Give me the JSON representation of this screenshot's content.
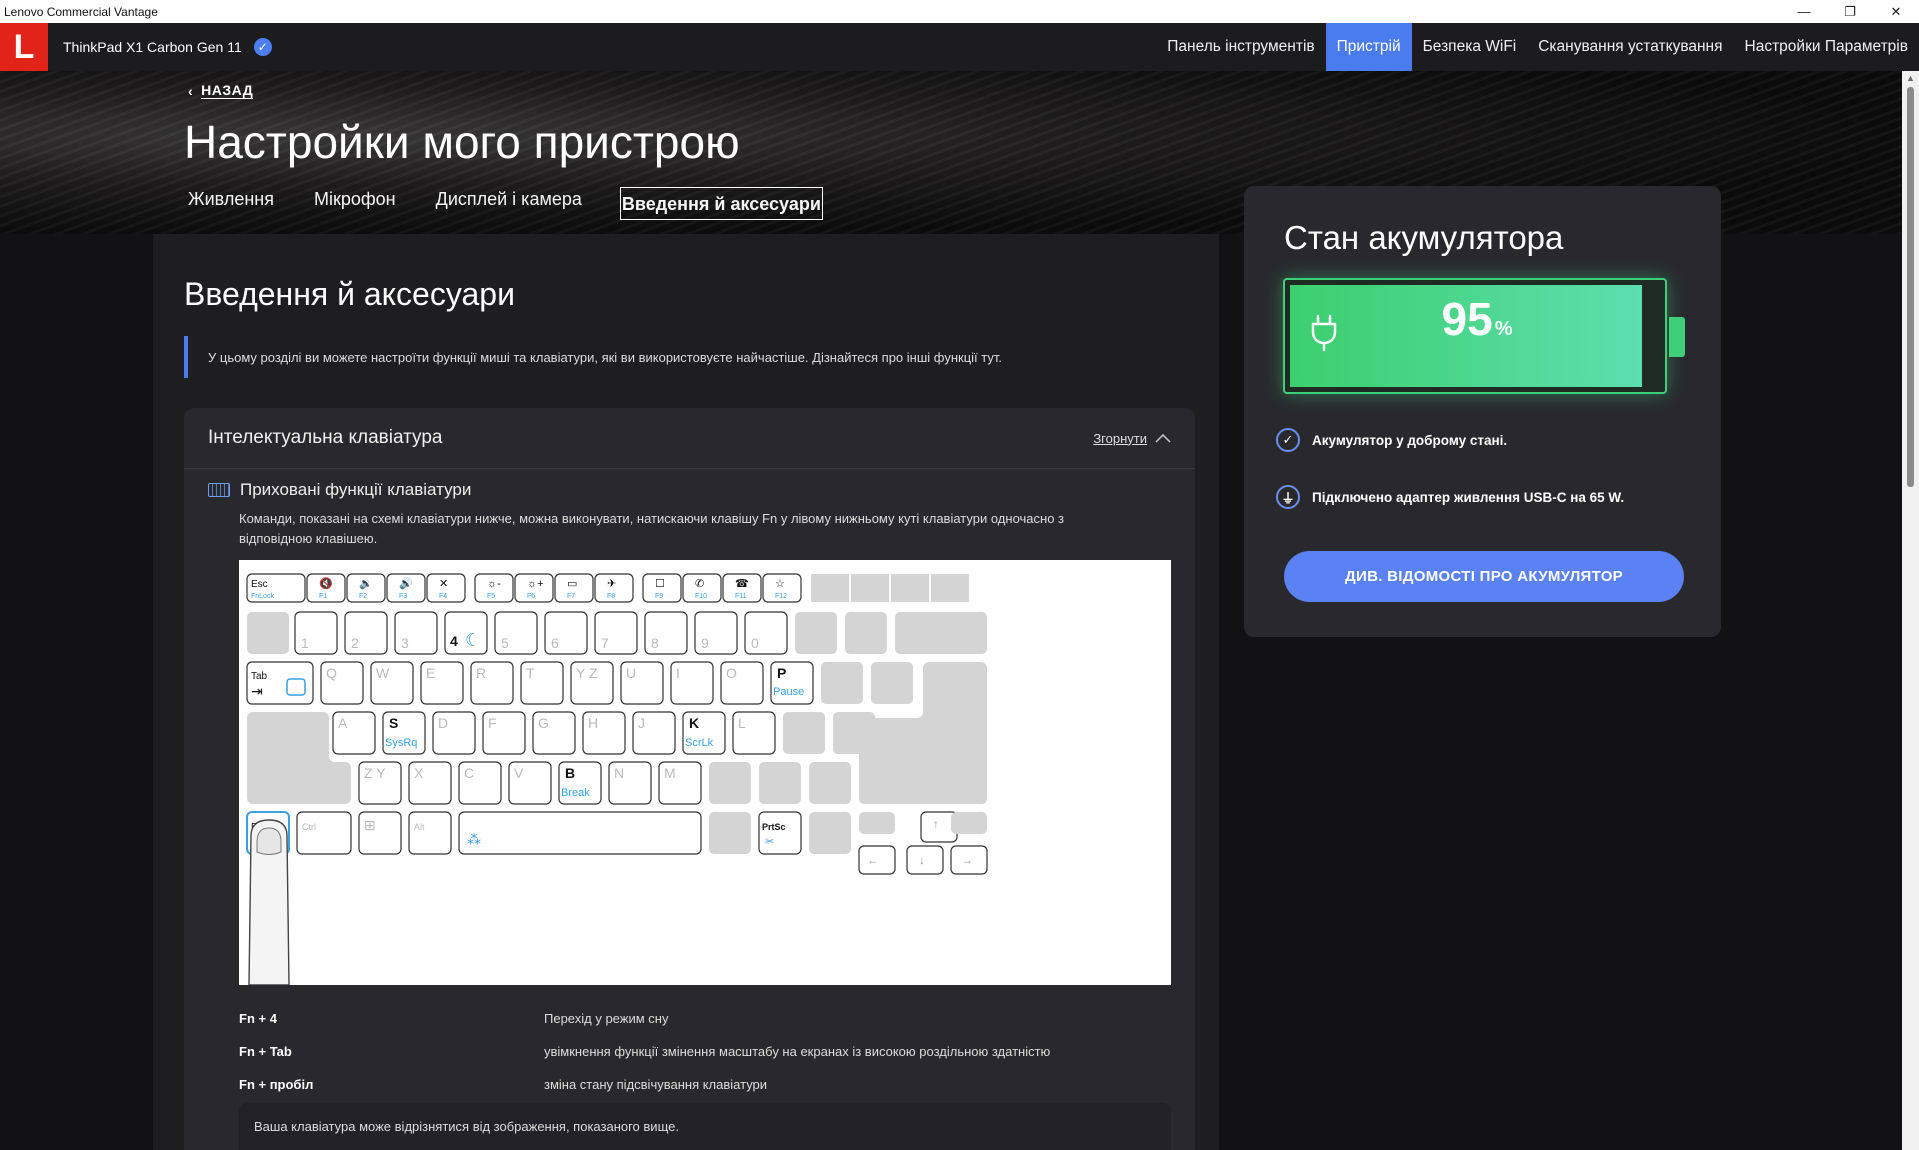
{
  "window": {
    "title": "Lenovo Commercial Vantage",
    "controls": [
      "—",
      "❐",
      "✕"
    ]
  },
  "header": {
    "logo_letter": "L",
    "device_name": "ThinkPad X1 Carbon Gen 11",
    "nav": [
      {
        "label": "Панель інструментів",
        "active": false
      },
      {
        "label": "Пристрій",
        "active": true
      },
      {
        "label": "Безпека WiFi",
        "active": false
      },
      {
        "label": "Сканування устаткування",
        "active": false
      },
      {
        "label": "Настройки Параметрів",
        "active": false
      }
    ]
  },
  "page": {
    "back_label": "НАЗАД",
    "title": "Настройки мого пристрою",
    "tabs": [
      {
        "label": "Живлення",
        "active": false
      },
      {
        "label": "Мікрофон",
        "active": false
      },
      {
        "label": "Дисплей і камера",
        "active": false
      },
      {
        "label": "Введення й аксесуари",
        "active": true
      }
    ]
  },
  "section": {
    "title": "Введення й аксесуари",
    "intro": "У цьому розділі ви можете настроїти функції миші та клавіатури, які ви використовуєте найчастіше. Дізнайтеся про інші функції тут.",
    "card": {
      "title": "Інтелектуальна клавіатура",
      "collapse_label": "Згорнути",
      "subtitle": "Приховані функції клавіатури",
      "description": "Команди, показані на схемі клавіатури нижче, можна виконувати, натискаючи клавішу Fn у лівому нижньому куті клавіатури одночасно з відповідною клавішею.",
      "shortcuts": [
        {
          "keys": "Fn + 4",
          "action": "Перехід у режим сну"
        },
        {
          "keys": "Fn + Tab",
          "action": "увімкнення функції змінення масштабу на екранах із високою роздільною здатністю"
        },
        {
          "keys": "Fn + пробіл",
          "action": "зміна стану підсвічування клавіатури"
        }
      ],
      "note": "Ваша клавіатура може відрізнятися від зображення, показаного вище."
    }
  },
  "keyboard": {
    "fn_row": [
      {
        "top": "Esc",
        "sub": "FnLock"
      },
      {
        "top": "🔇",
        "sub": "F1"
      },
      {
        "top": "🔉",
        "sub": "F2"
      },
      {
        "top": "🔊",
        "sub": "F3"
      },
      {
        "top": "✕",
        "sub": "F4"
      },
      {
        "top": "☼-",
        "sub": "F5"
      },
      {
        "top": "☼+",
        "sub": "F6"
      },
      {
        "top": "▭",
        "sub": "F7"
      },
      {
        "top": "✈",
        "sub": "F8"
      },
      {
        "top": "☐",
        "sub": "F9"
      },
      {
        "top": "✆",
        "sub": "F10"
      },
      {
        "top": "☎",
        "sub": "F11"
      },
      {
        "top": "☆",
        "sub": "F12"
      }
    ],
    "number_row": [
      "1",
      "2",
      "3",
      "4",
      "5",
      "6",
      "7",
      "8",
      "9",
      "0"
    ],
    "highlight": {
      "k4": {
        "main": "4",
        "alt": "☾"
      },
      "p": {
        "main": "P",
        "alt": "Pause"
      },
      "s": {
        "main": "S",
        "alt": "SysRq"
      },
      "k": {
        "main": "K",
        "alt": "ScrLk"
      },
      "b": {
        "main": "B",
        "alt": "Break"
      },
      "tab": {
        "main": "Tab",
        "alt": "⇥"
      },
      "fn": {
        "main": "Fn"
      },
      "prtsc": {
        "main": "PrtSc"
      }
    },
    "row_q": [
      "Q",
      "W",
      "E",
      "R",
      "T",
      "Y Z",
      "U",
      "I",
      "O"
    ],
    "row_a_left": [
      "A"
    ],
    "row_a_mid": [
      "D",
      "F",
      "G",
      "H",
      "J"
    ],
    "row_a_right": [
      "L"
    ],
    "row_z": [
      "Z Y",
      "X",
      "C",
      "V"
    ],
    "row_z_right": [
      "N",
      "M"
    ],
    "row_bottom": [
      "Ctrl",
      "⊞",
      "Alt"
    ]
  },
  "battery": {
    "title": "Стан акумулятора",
    "percent": "95",
    "percent_sign": "%",
    "level": 0.95,
    "status_health": "Акумулятор у доброму стані.",
    "status_adapter": "Підключено адаптер живлення USB-C на 65 W.",
    "details_button": "ДИВ. ВІДОМОСТІ ПРО АКУМУЛЯТОР",
    "color": "#3fcf7a"
  }
}
